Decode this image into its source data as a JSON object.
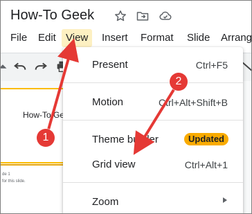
{
  "app": {
    "doc_title": "How-To Geek"
  },
  "title_icons": [
    "star-icon",
    "move-to-folder-icon",
    "cloud-status-icon"
  ],
  "menubar": [
    {
      "id": "file",
      "label": "File"
    },
    {
      "id": "edit",
      "label": "Edit"
    },
    {
      "id": "view",
      "label": "View",
      "active": true
    },
    {
      "id": "insert",
      "label": "Insert"
    },
    {
      "id": "format",
      "label": "Format"
    },
    {
      "id": "slide",
      "label": "Slide"
    },
    {
      "id": "arrange",
      "label": "Arrang"
    }
  ],
  "toolbar_icons": [
    "add-icon",
    "undo-icon",
    "redo-icon",
    "print-icon",
    "line-icon"
  ],
  "filmstrip": {
    "slide1_title": "How-To Gee",
    "slide2_line1": "de 1",
    "slide2_line2": "for this slide."
  },
  "view_menu": {
    "items": [
      {
        "label": "Present",
        "shortcut": "Ctrl+F5"
      },
      {
        "label": "Motion",
        "shortcut": "Ctrl+Alt+Shift+B"
      },
      {
        "label": "Theme builder",
        "badge": "Updated"
      },
      {
        "label": "Grid view",
        "shortcut": "Ctrl+Alt+1"
      },
      {
        "label": "Zoom",
        "submenu": true
      }
    ]
  },
  "annotations": {
    "callouts": [
      {
        "number": "1"
      },
      {
        "number": "2"
      }
    ]
  },
  "colors": {
    "active_menu_bg": "#fdf0c2",
    "badge_bg": "#f9ab00",
    "annotation_red": "#e53935",
    "slide_selected_border": "#fbbc04"
  }
}
